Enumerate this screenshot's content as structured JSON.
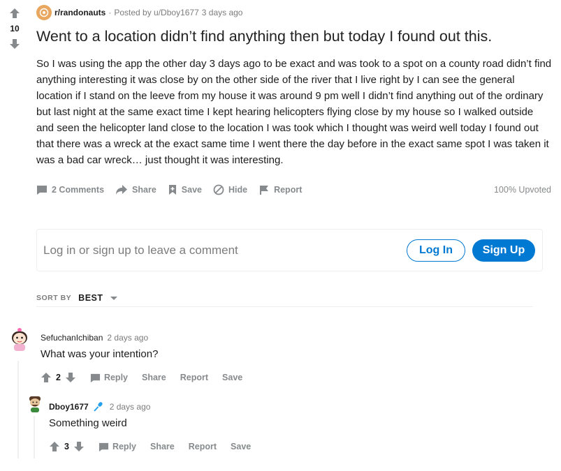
{
  "post": {
    "vote_count": "10",
    "subreddit": "r/randonauts",
    "separator": "·",
    "posted_by": "Posted by u/Dboy1677",
    "time": "3 days ago",
    "title": "Went to a location didn’t find anything then but today I found out this.",
    "body": "So I was using the app the other day 3 days ago to be exact and was took to a spot on a county road didn’t find anything interesting it was close by on the other side of the river that I live right by I can see the general location if I stand on the leeve from my house it was around 9 pm well I didn’t find anything out of the ordinary but last night at the same exact time I kept hearing helicopters flying close by my house so I walked outside and seen the helicopter land close to the location I was took which I thought was weird well today I found out that there was a wreck at the exact same time I went there the day before in the exact same spot I was taken it was a bad car wreck… just thought it was interesting.",
    "actions": {
      "comments": "2 Comments",
      "share": "Share",
      "save": "Save",
      "hide": "Hide",
      "report": "Report"
    },
    "upvoted": "100% Upvoted"
  },
  "login": {
    "prompt": "Log in or sign up to leave a comment",
    "login_label": "Log In",
    "signup_label": "Sign Up"
  },
  "sort": {
    "label": "SORT BY",
    "value": "BEST"
  },
  "comments": [
    {
      "author": "SefuchanIchiban",
      "time": "2 days ago",
      "text": "What was your intention?",
      "votes": "2",
      "reply": "Reply",
      "share": "Share",
      "report": "Report",
      "save": "Save"
    },
    {
      "author": "Dboy1677",
      "time": "2 days ago",
      "text": "Something weird",
      "votes": "3",
      "reply": "Reply",
      "share": "Share",
      "report": "Report",
      "save": "Save"
    }
  ],
  "colors": {
    "accent": "#0079d3",
    "muted": "#878a8c",
    "subreddit_icon": "#e8a65f",
    "op_flair": "#24a0ed"
  },
  "icons": {
    "upvote": "upvote-arrow-icon",
    "downvote": "downvote-arrow-icon",
    "comments": "comment-bubble-icon",
    "share": "share-arrow-icon",
    "save": "bookmark-plus-icon",
    "hide": "hide-circle-icon",
    "report": "flag-icon",
    "sort": "chevron-down-icon",
    "flair": "microphone-icon"
  }
}
